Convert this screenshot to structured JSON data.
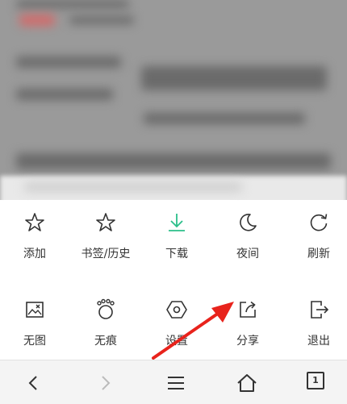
{
  "menu": {
    "row1": [
      {
        "label": "添加",
        "icon": "star-outline-icon"
      },
      {
        "label": "书签/历史",
        "icon": "star-outline-icon"
      },
      {
        "label": "下载",
        "icon": "download-icon"
      },
      {
        "label": "夜间",
        "icon": "moon-icon"
      },
      {
        "label": "刷新",
        "icon": "refresh-icon"
      }
    ],
    "row2": [
      {
        "label": "无图",
        "icon": "no-image-icon"
      },
      {
        "label": "无痕",
        "icon": "incognito-paw-icon"
      },
      {
        "label": "设置",
        "icon": "hexagon-settings-icon"
      },
      {
        "label": "分享",
        "icon": "share-icon"
      },
      {
        "label": "退出",
        "icon": "exit-icon"
      }
    ]
  },
  "bottom_bar": {
    "tab_count": "1"
  },
  "colors": {
    "accent_download": "#2bbf8a",
    "icon": "#333333",
    "annotation_arrow": "#e8231c"
  }
}
